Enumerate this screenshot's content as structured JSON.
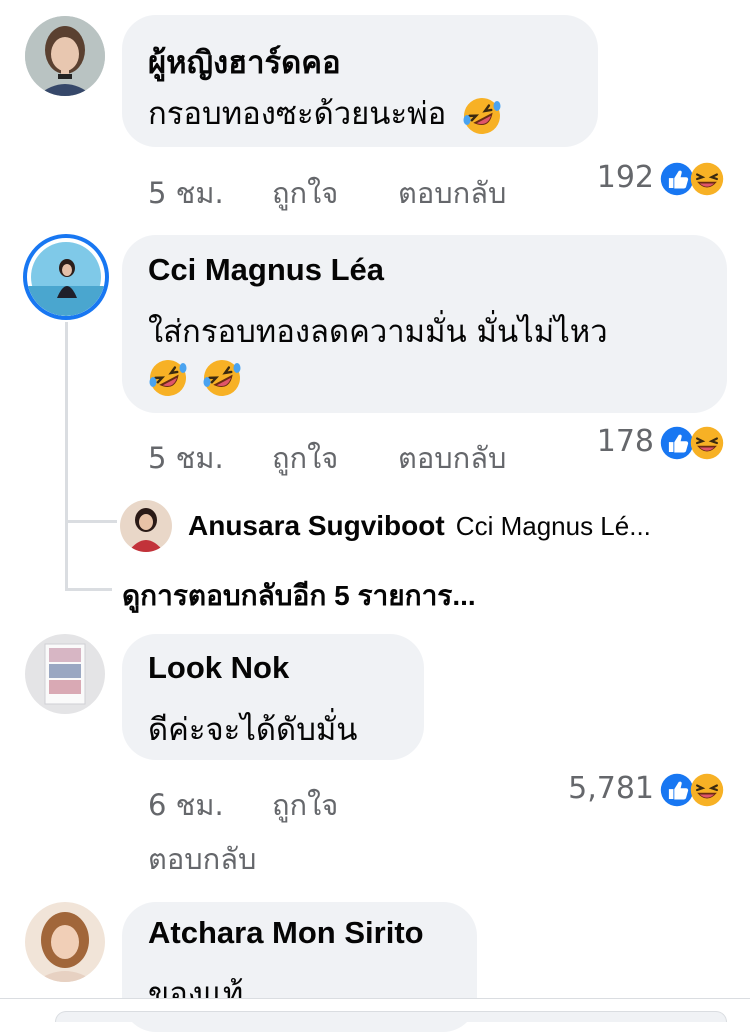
{
  "colors": {
    "bubble": "#f0f2f5",
    "meta_text": "#65676b",
    "like_blue": "#1877f2",
    "haha_yellow": "#f7b125",
    "active_ring": "#1877f2"
  },
  "comments": [
    {
      "name": "ผู้หญิงฮาร์ดคอ",
      "text_line1": "กรอบทองซะด้วยนะพ่อ",
      "text_emoji": "rolling-on-floor-laughing",
      "time": "5 ชม.",
      "like": "ถูกใจ",
      "reply": "ตอบกลับ",
      "reaction_count": "192",
      "reaction_icons": [
        "like-icon",
        "haha-icon"
      ]
    },
    {
      "name": "Cci Magnus Léa",
      "text_line1": "ใส่กรอบทองลดความมั่น มั่นไม่ไหว",
      "text_emojis": [
        "rolling-on-floor-laughing",
        "rolling-on-floor-laughing"
      ],
      "time": "5 ชม.",
      "like": "ถูกใจ",
      "reply": "ตอบกลับ",
      "reaction_count": "178",
      "reaction_icons": [
        "like-icon",
        "haha-icon"
      ],
      "reply_preview": {
        "name": "Anusara Sugviboot",
        "snippet": "Cci Magnus Lé..."
      },
      "more_replies": "ดูการตอบกลับอีก 5 รายการ..."
    },
    {
      "name": "Look Nok",
      "text_line1": "ดีค่ะจะได้ดับมั่น",
      "time": "6 ชม.",
      "like": "ถูกใจ",
      "reply": "ตอบกลับ",
      "reaction_count": "5,781",
      "reaction_icons": [
        "like-icon",
        "haha-icon"
      ]
    },
    {
      "name": "Atchara Mon Sirito",
      "text_line1": "ของแท้"
    }
  ]
}
